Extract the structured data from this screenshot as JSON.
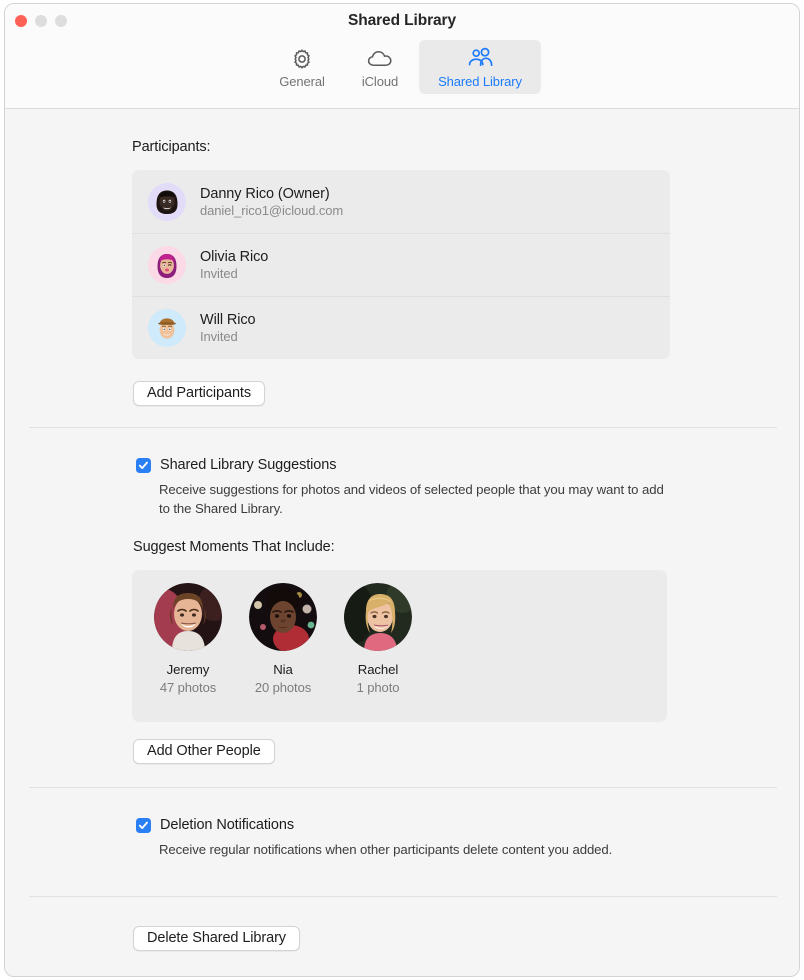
{
  "window": {
    "title": "Shared Library",
    "traffic_lights": [
      "close",
      "minimize",
      "zoom"
    ]
  },
  "toolbar": {
    "tabs": [
      {
        "label": "General",
        "icon": "gear-icon",
        "selected": false
      },
      {
        "label": "iCloud",
        "icon": "cloud-icon",
        "selected": false
      },
      {
        "label": "Shared Library",
        "icon": "people-icon",
        "selected": true
      }
    ],
    "accent_color": "#1c7bfb"
  },
  "participants_section": {
    "label": "Participants:",
    "items": [
      {
        "name": "Danny Rico (Owner)",
        "sub": "daniel_rico1@icloud.com",
        "avatar": "memoji-danny",
        "avatar_bg": "#e3dcf8",
        "skin": "#2e2320",
        "hair": "#1a1210"
      },
      {
        "name": "Olivia Rico",
        "sub": "Invited",
        "avatar": "memoji-olivia",
        "avatar_bg": "#fcd9e6",
        "skin": "#e8b89a",
        "hair": "#a41f8a"
      },
      {
        "name": "Will Rico",
        "sub": "Invited",
        "avatar": "memoji-will",
        "avatar_bg": "#cfeafb",
        "skin": "#efc29c",
        "hair": "#9c6b34"
      }
    ],
    "add_button": "Add Participants"
  },
  "suggestions_section": {
    "checkbox_label": "Shared Library Suggestions",
    "checkbox_checked": true,
    "description": "Receive suggestions for photos and videos of selected people that you may want to add to the Shared Library.",
    "moments_label": "Suggest Moments That Include:",
    "people": [
      {
        "name": "Jeremy",
        "count": "47 photos",
        "photo": "portrait-jeremy"
      },
      {
        "name": "Nia",
        "count": "20 photos",
        "photo": "portrait-nia"
      },
      {
        "name": "Rachel",
        "count": "1 photo",
        "photo": "portrait-rachel"
      }
    ],
    "add_button": "Add Other People"
  },
  "deletion_section": {
    "checkbox_label": "Deletion Notifications",
    "checkbox_checked": true,
    "description": "Receive regular notifications when other participants delete content you added."
  },
  "footer": {
    "delete_button": "Delete Shared Library"
  },
  "colors": {
    "accent": "#1c7bfb",
    "checkbox": "#2b7ff5",
    "window_bg": "#f5f5f5",
    "panel_bg": "#ebebeb",
    "close_light": "#ff6157"
  }
}
